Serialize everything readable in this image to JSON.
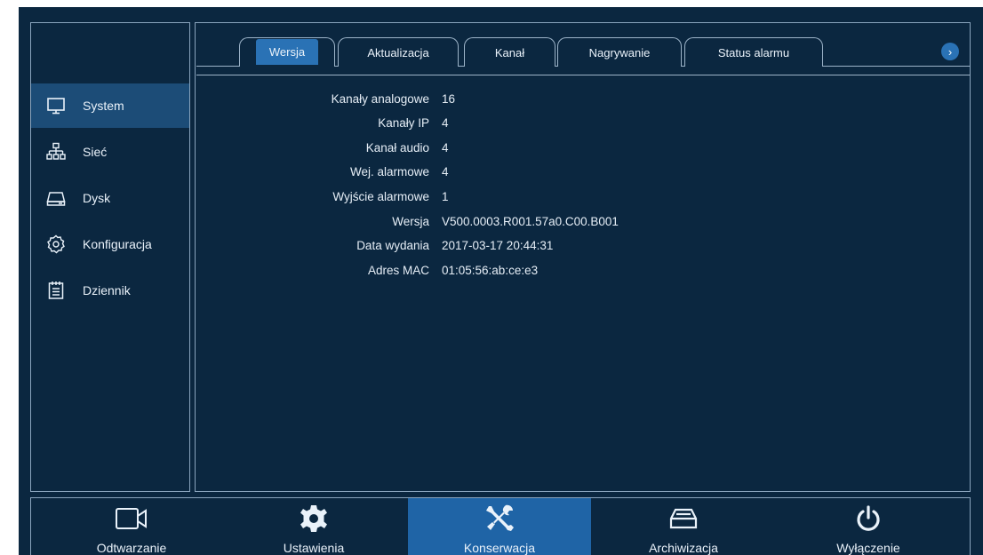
{
  "sidebar": {
    "items": [
      {
        "label": "System",
        "icon": "monitor-icon",
        "active": true
      },
      {
        "label": "Sieć",
        "icon": "network-icon",
        "active": false
      },
      {
        "label": "Dysk",
        "icon": "hdd-icon",
        "active": false
      },
      {
        "label": "Konfiguracja",
        "icon": "gear-outline-icon",
        "active": false
      },
      {
        "label": "Dziennik",
        "icon": "log-icon",
        "active": false
      }
    ]
  },
  "tabs": {
    "items": [
      {
        "label": "Wersja",
        "active": true
      },
      {
        "label": "Aktualizacja",
        "active": false
      },
      {
        "label": "Kanał",
        "active": false
      },
      {
        "label": "Nagrywanie",
        "active": false
      },
      {
        "label": "Status alarmu",
        "active": false
      }
    ],
    "next_icon": "chevron-right-icon",
    "next_glyph": "›"
  },
  "info": {
    "rows": [
      {
        "label": "Kanały analogowe",
        "value": "16"
      },
      {
        "label": "Kanały IP",
        "value": "4"
      },
      {
        "label": "Kanał audio",
        "value": "4"
      },
      {
        "label": "Wej. alarmowe",
        "value": "4"
      },
      {
        "label": "Wyjście alarmowe",
        "value": "1"
      },
      {
        "label": "Wersja",
        "value": "V500.0003.R001.57a0.C00.B001"
      },
      {
        "label": "Data wydania",
        "value": "2017-03-17 20:44:31"
      },
      {
        "label": "Adres MAC",
        "value": "01:05:56:ab:ce:e3"
      }
    ]
  },
  "bottombar": {
    "items": [
      {
        "label": "Odtwarzanie",
        "icon": "camera-icon",
        "active": false
      },
      {
        "label": "Ustawienia",
        "icon": "gear-icon",
        "active": false
      },
      {
        "label": "Konserwacja",
        "icon": "tools-icon",
        "active": true
      },
      {
        "label": "Archiwizacja",
        "icon": "archive-drive-icon",
        "active": false
      },
      {
        "label": "Wyłączenie",
        "icon": "power-icon",
        "active": false
      }
    ]
  },
  "colors": {
    "background": "#0b2740",
    "accent": "#2a72b5",
    "active_sidebar": "#1c4c77",
    "active_bottom": "#1f64a6",
    "border": "#8aa4bd"
  }
}
